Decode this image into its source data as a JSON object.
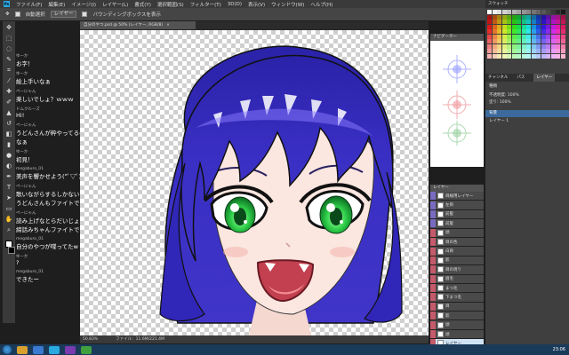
{
  "menubar": {
    "app_logo": "Ps",
    "items": [
      "ファイル(F)",
      "編集(E)",
      "イメージ(I)",
      "レイヤー(L)",
      "書式(Y)",
      "選択範囲(S)",
      "フィルター(T)",
      "3D(D)",
      "表示(V)",
      "ウィンドウ(W)",
      "ヘルプ(H)"
    ]
  },
  "options_bar": {
    "sample": "レイヤー",
    "auto_select_label": "自動選択",
    "transform_label": "バウンディングボックスを表示"
  },
  "chat": {
    "messages": [
      {
        "name": "ゆーか",
        "text": "お字！"
      },
      {
        "name": "ゆーか",
        "text": "絵上手いなぁ"
      },
      {
        "name": "ぺーにゃん",
        "text": "楽しいでしょ？ｗｗｗ"
      },
      {
        "name": "ドムクルーズ",
        "text": "Hi!"
      },
      {
        "name": "ぺーにゃん",
        "text": "うどんさんが粋やってるの"
      },
      {
        "name": "",
        "text": "なぁ"
      },
      {
        "name": "ゆーか",
        "text": "初見！"
      },
      {
        "name": "megaburo_01",
        "text": "美声を響かせよう(*ﾟ▽ﾟ)"
      },
      {
        "name": "ぺーにゃん",
        "text": "歌いながらするしかないな"
      },
      {
        "name": "",
        "text": "うどんさんもファイトです"
      },
      {
        "name": "ぺーにゃん",
        "text": "読み上げなとらだいじょ"
      },
      {
        "name": "",
        "text": "締話みちゃんファイトです"
      },
      {
        "name": "megaburo_01",
        "text": "自分のやつが喋ってたw"
      },
      {
        "name": "ゆーか",
        "text": "?"
      },
      {
        "name": "megaburo_01",
        "text": "できたー"
      }
    ]
  },
  "document": {
    "tab_title": "自分のやつ.psd @ 50% (レイヤー, RGB/8)",
    "zoom": "50.83%",
    "file_info": "ファイル：11.6M/221.4M"
  },
  "navigator": {
    "title": "ナビゲーター"
  },
  "layers_mini": {
    "title": "レイヤー",
    "rows": [
      "目線用レイヤー",
      "左目",
      "前髪",
      "前髪",
      "顔",
      "目の色",
      "白目",
      "影",
      "目の周り",
      "眉毛",
      "まつ毛",
      "下まつ毛",
      "目",
      "影",
      "顔",
      "顔",
      "レイヤー",
      "顔",
      "髪",
      "肌"
    ],
    "selected_index": 18
  },
  "right_panel": {
    "swatches_title": "スウォッチ",
    "tabs": [
      "チャンネル",
      "パス",
      "レイヤー"
    ],
    "active_tab": "レイヤー",
    "kind_label": "種類",
    "opacity_label": "不透明度: 100%",
    "fill_label": "塗り: 100%",
    "layer_rows": [
      "背景",
      "レイヤー 1"
    ]
  },
  "taskbar": {
    "clock": "23:06"
  },
  "colors": {
    "hair": "#3a2fc4",
    "hair_light": "#6a5cf0",
    "hair_dark": "#1a1470",
    "eye": "#2fd04a",
    "skin": "#fbe6e0",
    "mouth": "#d8536a",
    "accent": "#2aa8e0"
  }
}
